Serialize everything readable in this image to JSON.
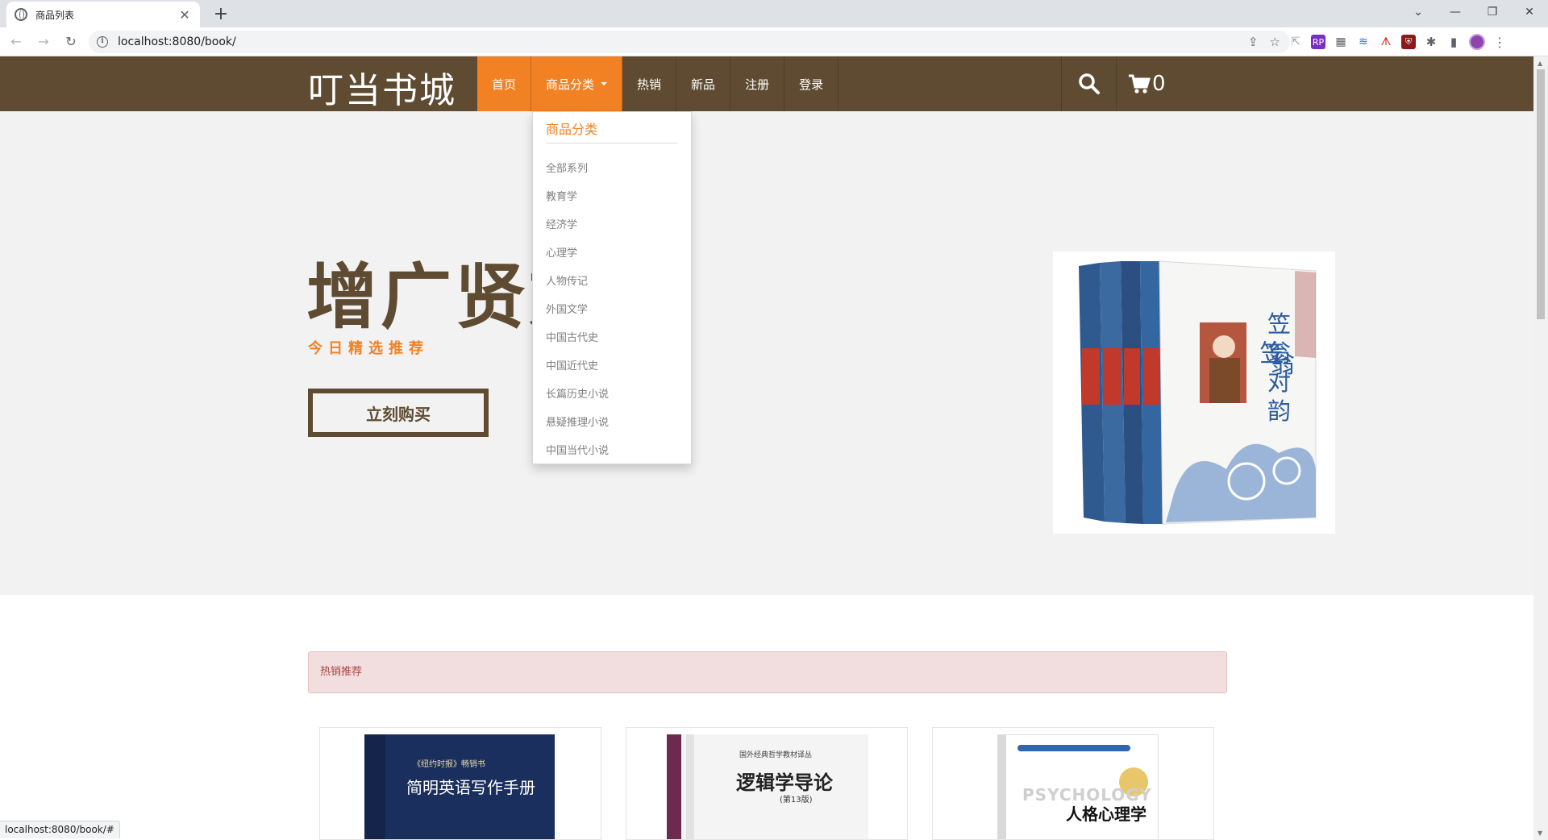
{
  "browser": {
    "tab_title": "商品列表",
    "url": "localhost:8080/book/",
    "status_url": "localhost:8080/book/#"
  },
  "nav": {
    "brand": "叮当书城",
    "items": [
      {
        "label": "首页"
      },
      {
        "label": "商品分类"
      },
      {
        "label": "热销"
      },
      {
        "label": "新品"
      },
      {
        "label": "注册"
      },
      {
        "label": "登录"
      }
    ],
    "cart_count": "0"
  },
  "dropdown": {
    "header": "商品分类",
    "items": [
      "全部系列",
      "教育学",
      "经济学",
      "心理学",
      "人物传记",
      "外国文学",
      "中国古代史",
      "中国近代史",
      "长篇历史小说",
      "悬疑推理小说",
      "中国当代小说"
    ]
  },
  "hero": {
    "title": "增广贤文",
    "subtitle": "今日精选推荐",
    "button": "立刻购买",
    "cover_text": "笠翁对韵"
  },
  "hot_section": {
    "label": "热销推荐"
  },
  "products": [
    {
      "cover_title": "简明英语写作手册",
      "color": "#1b2f5e"
    },
    {
      "cover_title": "逻辑学导论",
      "color": "#f4f4f4"
    },
    {
      "cover_title": "人格心理学",
      "color": "#ffffff"
    }
  ],
  "colors": {
    "nav_bg": "#5f4b32",
    "accent": "#f28123",
    "hero_bg": "#f2f2f2",
    "alert_bg": "#f2dede",
    "alert_text": "#a94442"
  }
}
